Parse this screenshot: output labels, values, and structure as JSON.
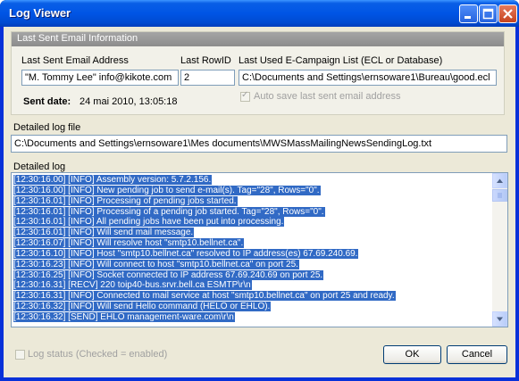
{
  "window": {
    "title": "Log Viewer"
  },
  "group": {
    "header": "Last Sent Email Information",
    "email_label": "Last Sent Email Address",
    "email_value": "\"M. Tommy Lee\" info@kikote.com",
    "rowid_label": "Last RowID",
    "rowid_value": "2",
    "ecl_label": "Last Used E-Campaign List (ECL or Database)",
    "ecl_value": "C:\\Documents and Settings\\ernsoware1\\Bureau\\good.ecl",
    "autosave_label": "Auto save last sent email address",
    "sent_date_label": "Sent date:",
    "sent_date_value": "24 mai 2010, 13:05:18"
  },
  "logfile": {
    "label": "Detailed log file",
    "value": "C:\\Documents and Settings\\ernsoware1\\Mes documents\\MWSMassMailingNewsSendingLog.txt"
  },
  "detailed_log": {
    "label": "Detailed log",
    "lines": [
      "[12:30:16.00] [INFO] Assembly version: 5.7.2.156.",
      "[12:30:16.00] [INFO] New pending job to send e-mail(s). Tag=\"28\", Rows=\"0\".",
      "[12:30:16.01] [INFO] Processing of pending jobs started.",
      "[12:30:16.01] [INFO] Processing of a pending job started. Tag=\"28\", Rows=\"0\".",
      "[12:30:16.01] [INFO] All pending jobs have been put into processing.",
      "[12:30:16.01] [INFO] Will send mail message.",
      "[12:30:16.07] [INFO] Will resolve host \"smtp10.bellnet.ca\".",
      "[12:30:16.10] [INFO] Host \"smtp10.bellnet.ca\" resolved to IP address(es) 67.69.240.69.",
      "[12:30:16.23] [INFO] Will connect to host \"smtp10.bellnet.ca\" on port 25.",
      "[12:30:16.25] [INFO] Socket connected to IP address 67.69.240.69 on port 25.",
      "[12:30:16.31] [RECV] 220 toip40-bus.srvr.bell.ca ESMTP\\r\\n",
      "[12:30:16.31] [INFO] Connected to mail service at host \"smtp10.bellnet.ca\" on port 25 and ready.",
      "[12:30:16.32] [INFO] Will send Hello command (HELO or EHLO).",
      "[12:30:16.32] [SEND] EHLO management-ware.com\\r\\n"
    ]
  },
  "footer": {
    "log_status_label": "Log status (Checked = enabled)",
    "ok_label": "OK",
    "cancel_label": "Cancel"
  },
  "colors": {
    "titlebar": "#0055e5",
    "selection": "#316ac5",
    "dialog_bg": "#ece9d8"
  }
}
